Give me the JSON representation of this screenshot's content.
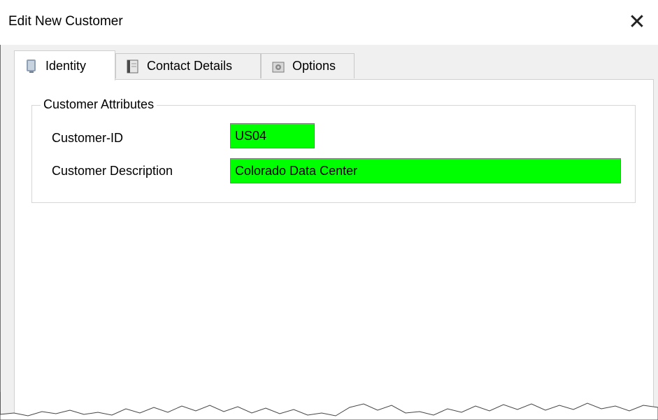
{
  "window": {
    "title": "Edit New Customer",
    "close_icon": "close-icon"
  },
  "tabs": [
    {
      "label": "Identity",
      "icon": "identity-icon",
      "active": true
    },
    {
      "label": "Contact Details",
      "icon": "contact-details-icon",
      "active": false
    },
    {
      "label": "Options",
      "icon": "options-icon",
      "active": false
    }
  ],
  "group": {
    "label": "Customer Attributes"
  },
  "fields": {
    "customer_id": {
      "label": "Customer-ID",
      "value": "US04"
    },
    "customer_description": {
      "label": "Customer Description",
      "value": "Colorado Data Center"
    }
  },
  "colors": {
    "field_background": "#00ff00",
    "window_background": "#f0f0f0"
  }
}
